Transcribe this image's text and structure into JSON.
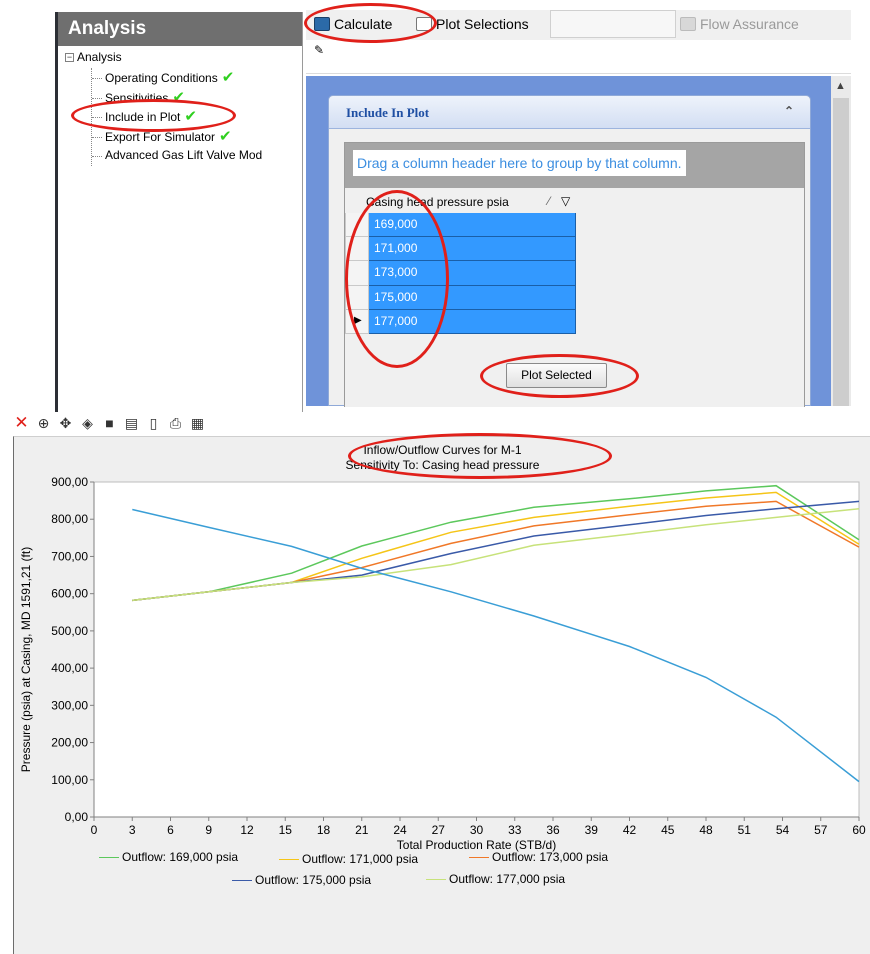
{
  "tree": {
    "header": "Analysis",
    "root": "Analysis",
    "items": [
      {
        "label": "Operating Conditions",
        "checked": true
      },
      {
        "label": "Sensitivities",
        "checked": true
      },
      {
        "label": "Include in Plot",
        "checked": true
      },
      {
        "label": "Export For Simulator",
        "checked": true
      },
      {
        "label": "Advanced Gas Lift Valve Mod",
        "checked": false
      }
    ]
  },
  "toolbar": {
    "calculate_label": "Calculate",
    "plot_selections_label": "Plot Selections",
    "flow_assurance_label": "Flow Assurance"
  },
  "include_panel": {
    "title": "Include In Plot",
    "group_hint": "Drag a column header here to group by that column.",
    "column_header": "Casing head pressure psia",
    "rows": [
      "169,000",
      "171,000",
      "173,000",
      "175,000",
      "177,000"
    ],
    "plot_button": "Plot Selected"
  },
  "chart_data": {
    "type": "line",
    "title": "Inflow/Outflow Curves for M-1",
    "subtitle": "Sensitivity To: Casing head pressure",
    "xlabel": "Total Production Rate (STB/d)",
    "ylabel": "Pressure (psia) at Casing, MD 1591,21 (ft)",
    "xlim": [
      0,
      60
    ],
    "ylim": [
      0,
      900
    ],
    "x_ticks": [
      "0",
      "3",
      "6",
      "9",
      "12",
      "15",
      "18",
      "21",
      "24",
      "27",
      "30",
      "33",
      "36",
      "39",
      "42",
      "45",
      "48",
      "51",
      "54",
      "57",
      "60"
    ],
    "y_ticks": [
      "0,00",
      "100,00",
      "200,00",
      "300,00",
      "400,00",
      "500,00",
      "600,00",
      "700,00",
      "800,00",
      "900,00"
    ],
    "grid": false,
    "legend_position": "bottom",
    "series": [
      {
        "name": "Outflow: 169,000 psia",
        "color": "#5cc85c",
        "x": [
          3,
          9,
          15.5,
          21,
          28,
          34.5,
          42,
          48,
          53.5,
          60
        ],
        "y": [
          582,
          605,
          655,
          728,
          792,
          832,
          855,
          876,
          890,
          745
        ]
      },
      {
        "name": "Outflow: 171,000 psia",
        "color": "#f5c518",
        "x": [
          3,
          9,
          15.5,
          21,
          28,
          34.5,
          42,
          48,
          53.5,
          60
        ],
        "y": [
          582,
          605,
          630,
          695,
          765,
          805,
          835,
          857,
          872,
          733
        ]
      },
      {
        "name": "Outflow: 173,000 psia",
        "color": "#f07828",
        "x": [
          3,
          9,
          15.5,
          21,
          28,
          34.5,
          42,
          48,
          53.5,
          60
        ],
        "y": [
          582,
          605,
          630,
          670,
          735,
          782,
          812,
          835,
          848,
          725
        ]
      },
      {
        "name": "Outflow: 175,000 psia",
        "color": "#3a5aa8",
        "x": [
          3,
          9,
          15.5,
          21,
          28,
          34.5,
          42,
          48,
          53.5,
          60
        ],
        "y": [
          582,
          605,
          630,
          650,
          708,
          755,
          785,
          810,
          828,
          848
        ]
      },
      {
        "name": "Outflow: 177,000 psia",
        "color": "#c7e27a",
        "x": [
          3,
          9,
          15.5,
          21,
          28,
          34.5,
          42,
          48,
          53.5,
          60
        ],
        "y": [
          582,
          605,
          630,
          645,
          678,
          730,
          760,
          785,
          805,
          828
        ]
      },
      {
        "name": "",
        "color": "#3a9ed6",
        "x": [
          3,
          9,
          15.5,
          21,
          28,
          34.5,
          42,
          48,
          53.5,
          60
        ],
        "y": [
          826,
          778,
          727,
          668,
          605,
          540,
          458,
          375,
          268,
          95
        ]
      }
    ]
  }
}
